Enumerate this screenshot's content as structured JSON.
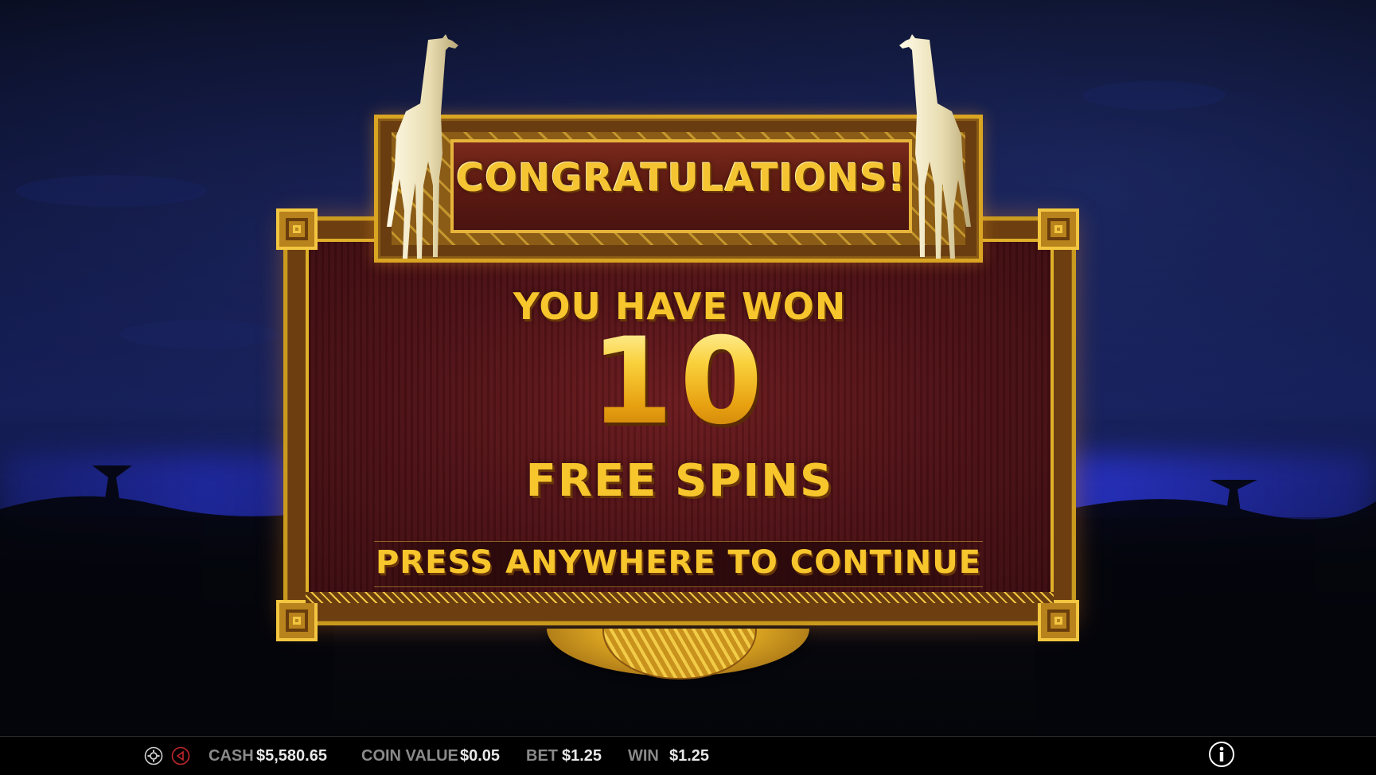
{
  "popup": {
    "title": "CONGRATULATIONS!",
    "won_line": "YOU HAVE WON",
    "spin_count": "10",
    "spins_label": "FREE SPINS",
    "continue_prompt": "PRESS ANYWHERE TO CONTINUE"
  },
  "status_bar": {
    "cash_label": "CASH",
    "cash_value": "$5,580.65",
    "coin_value_label": "COIN VALUE",
    "coin_value": "$0.05",
    "bet_label": "BET",
    "bet_value": "$1.25",
    "win_label": "WIN",
    "win_value": "$1.25"
  },
  "icons": {
    "settings": "gear-icon",
    "sound": "sound-icon",
    "info": "info-icon",
    "decor": "giraffe-icon"
  },
  "colors": {
    "gold": "#f7c52c",
    "frame_brown": "#6a3d10",
    "panel_maroon": "#4b1014",
    "night_blue": "#121b52"
  }
}
